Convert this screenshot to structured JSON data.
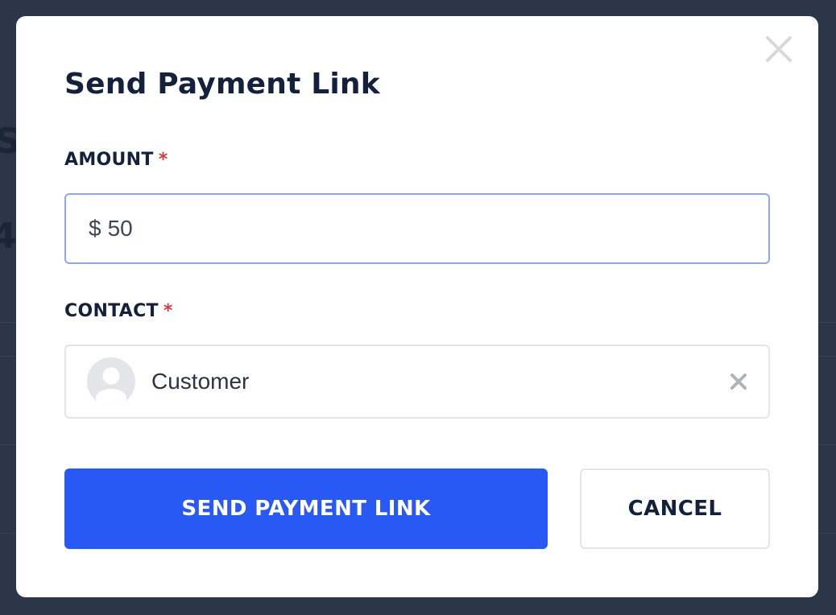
{
  "modal": {
    "title": "Send Payment Link",
    "amount": {
      "label": "AMOUNT",
      "required_marker": "*",
      "currency_symbol": "$",
      "value": "50"
    },
    "contact": {
      "label": "CONTACT",
      "required_marker": "*",
      "selected_name": "Customer",
      "avatar_icon": "user-placeholder-icon",
      "clear_icon": "clear-x-icon"
    },
    "buttons": {
      "send_label": "SEND PAYMENT LINK",
      "cancel_label": "CANCEL"
    },
    "close_icon": "close-x-icon"
  },
  "colors": {
    "primary": "#2859f5",
    "heading": "#13213d",
    "required": "#d63a3a",
    "focus_border": "#8fa6f4",
    "overlay": "#2b3648"
  }
}
